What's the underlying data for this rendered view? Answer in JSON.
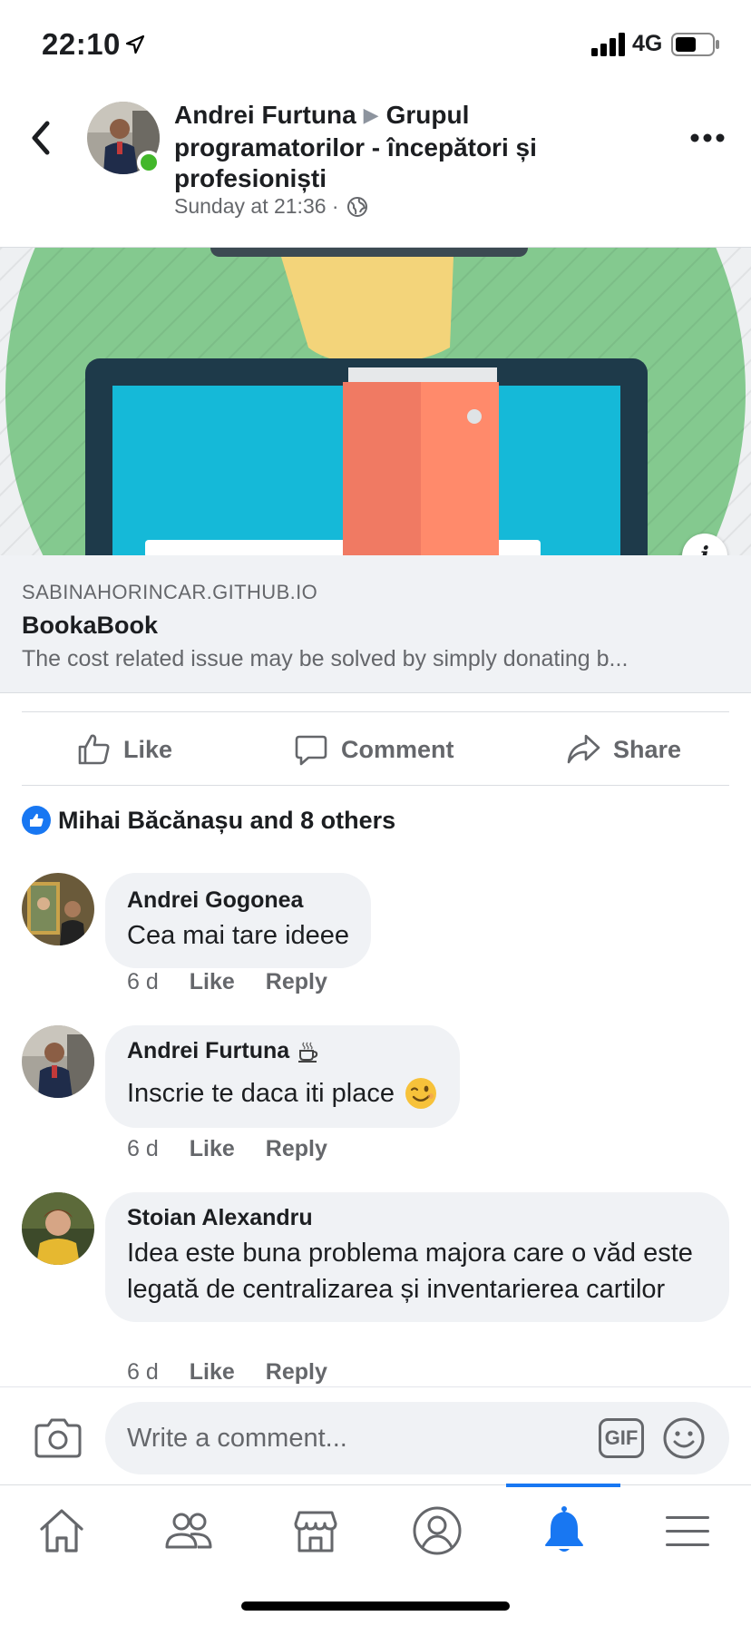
{
  "status_bar": {
    "time": "22:10",
    "network": "4G"
  },
  "post": {
    "author": "Andrei Furtuna",
    "group": "Grupul programatorilor - începători și profesioniști",
    "timestamp": "Sunday at 21:36 ·"
  },
  "link_preview": {
    "domain": "SABINAHORINCAR.GITHUB.IO",
    "title": "BookaBook",
    "description": "The cost related issue may be solved by simply donating b..."
  },
  "actions": {
    "like": "Like",
    "comment": "Comment",
    "share": "Share"
  },
  "reactions": {
    "summary": "Mihai Băcănașu and 8 others"
  },
  "comments": [
    {
      "name": "Andrei Gogonea",
      "text": "Cea mai tare ideee",
      "time": "6 d",
      "like": "Like",
      "reply": "Reply"
    },
    {
      "name": "Andrei Furtuna",
      "text": "Inscrie te daca iti place",
      "time": "6 d",
      "like": "Like",
      "reply": "Reply"
    },
    {
      "name": "Stoian Alexandru",
      "text": "Idea este buna problema majora care o văd este legată de centralizarea și inventarierea cartilor",
      "time": "6 d",
      "like": "Like",
      "reply": "Reply"
    }
  ],
  "composer": {
    "placeholder": "Write a comment...",
    "gif_label": "GIF"
  },
  "colors": {
    "accent": "#1877f2",
    "online": "#42b72a",
    "secondary_text": "#65676b",
    "bubble_bg": "#f0f2f5"
  },
  "icons": [
    "location-arrow-icon",
    "signal-icon",
    "battery-icon",
    "back-chevron-icon",
    "more-icon",
    "globe-icon",
    "info-icon",
    "like-icon",
    "comment-icon",
    "share-icon",
    "coffee-icon",
    "wink-emoji-icon",
    "camera-icon",
    "gif-icon",
    "emoji-icon",
    "home-icon",
    "friends-icon",
    "marketplace-icon",
    "profile-icon",
    "notifications-icon",
    "menu-icon"
  ]
}
